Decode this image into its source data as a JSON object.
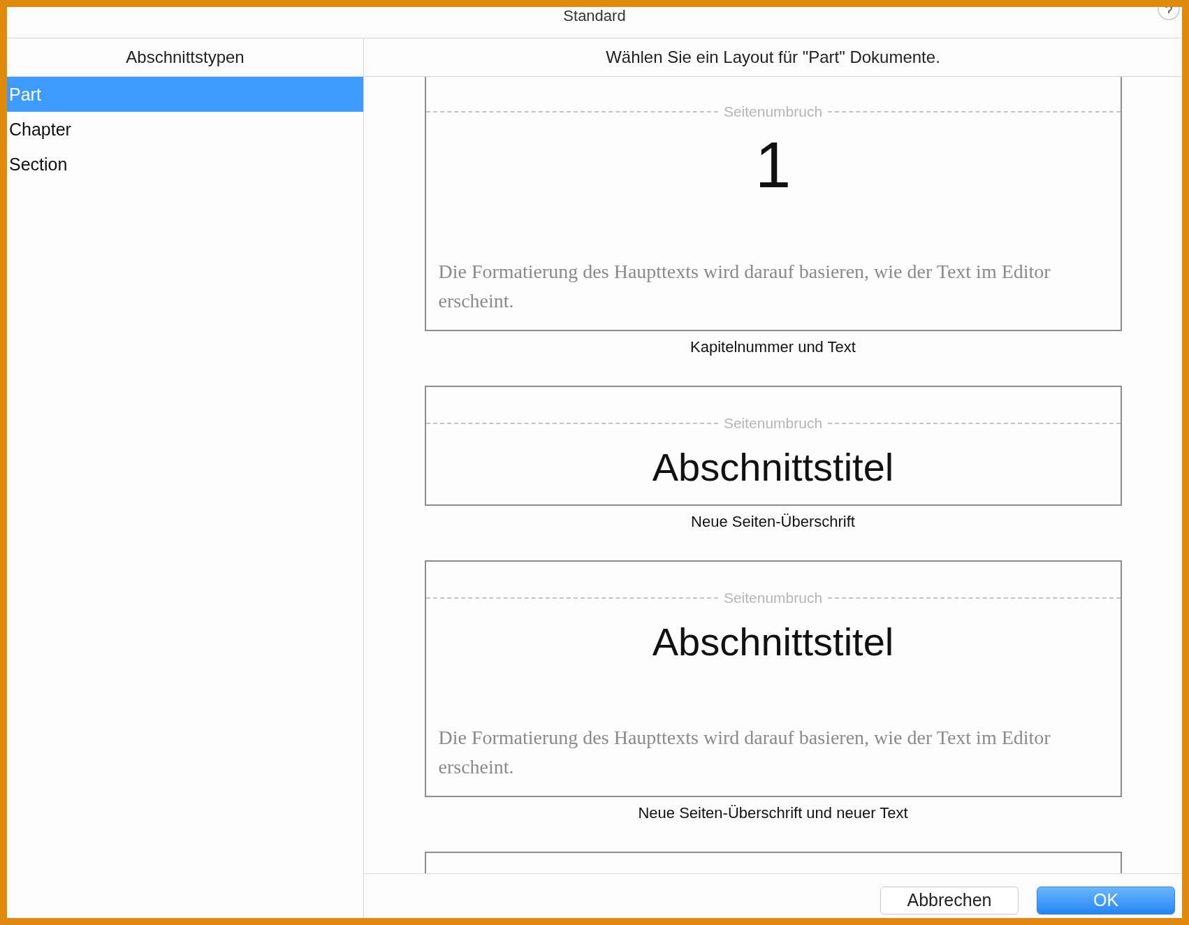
{
  "window": {
    "title": "Standard"
  },
  "sidebar": {
    "heading": "Abschnittstypen",
    "items": [
      {
        "label": "Part",
        "selected": true
      },
      {
        "label": "Chapter",
        "selected": false
      },
      {
        "label": "Section",
        "selected": false
      }
    ]
  },
  "content": {
    "heading": "Wählen Sie ein Layout für \"Part\" Dokumente.",
    "layouts": [
      {
        "kind": "number",
        "page_break": "Seitenumbruch",
        "heading": "1",
        "body": "Die Formatierung des Haupttexts wird darauf basieren, wie der Text im Editor erscheint.",
        "caption": "Kapitelnummer und Text"
      },
      {
        "kind": "title",
        "page_break": "Seitenumbruch",
        "heading": "Abschnittstitel",
        "caption": "Neue Seiten-Überschrift"
      },
      {
        "kind": "title",
        "page_break": "Seitenumbruch",
        "heading": "Abschnittstitel",
        "body": "Die Formatierung des Haupttexts wird darauf basieren, wie der Text im Editor erscheint.",
        "caption": "Neue Seiten-Überschrift und neuer Text"
      },
      {
        "kind": "empty"
      }
    ]
  },
  "buttons": [
    {
      "label": "Abbrechen",
      "kind": "secondary"
    },
    {
      "label": "OK",
      "kind": "primary"
    }
  ]
}
